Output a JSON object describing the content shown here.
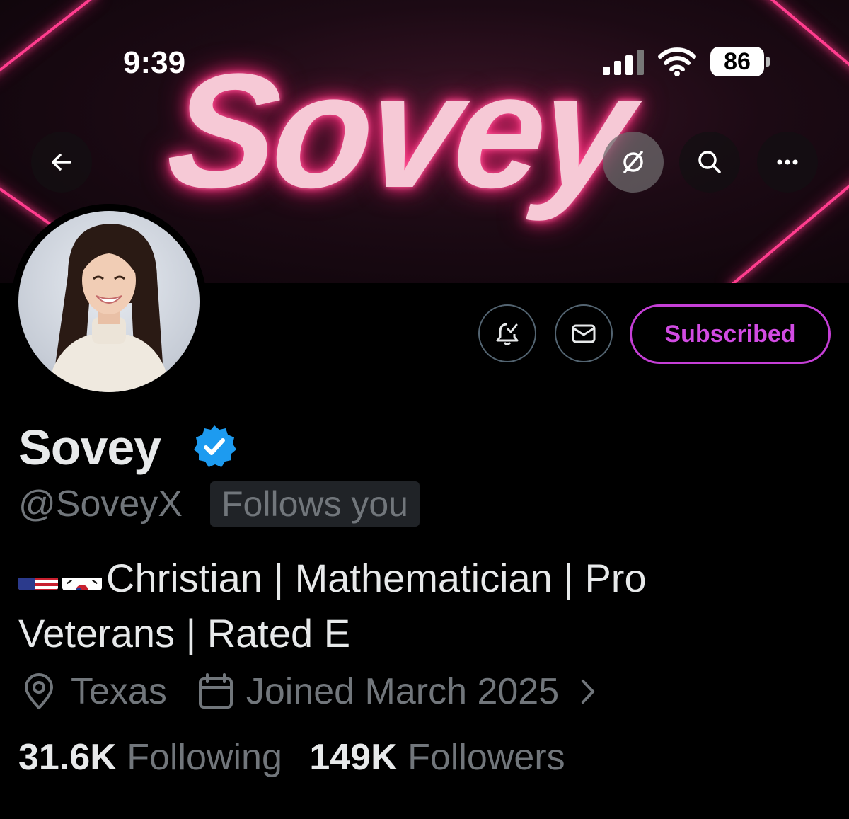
{
  "status_bar": {
    "time": "9:39",
    "battery": "86"
  },
  "banner": {
    "text": "Sovey"
  },
  "header": {
    "back_icon": "arrow-left-icon",
    "grok_icon": "grok-icon",
    "search_icon": "search-icon",
    "more_icon": "more-icon"
  },
  "actions": {
    "notify_icon": "bell-check-icon",
    "message_icon": "envelope-icon",
    "subscribed_label": "Subscribed"
  },
  "profile": {
    "name": "Sovey",
    "handle": "@SoveyX",
    "follows_you": "Follows you",
    "bio_text": "Christian | Mathematician | Pro Veterans | Rated E",
    "location": "Texas",
    "joined": "Joined March 2025",
    "following_count": "31.6K",
    "following_label": "Following",
    "followers_count": "149K",
    "followers_label": "Followers"
  },
  "colors": {
    "accent_purple": "#d24be3",
    "verified_blue": "#1d9bf0",
    "neon_pink": "#ff3d8e",
    "muted": "#71767b"
  }
}
